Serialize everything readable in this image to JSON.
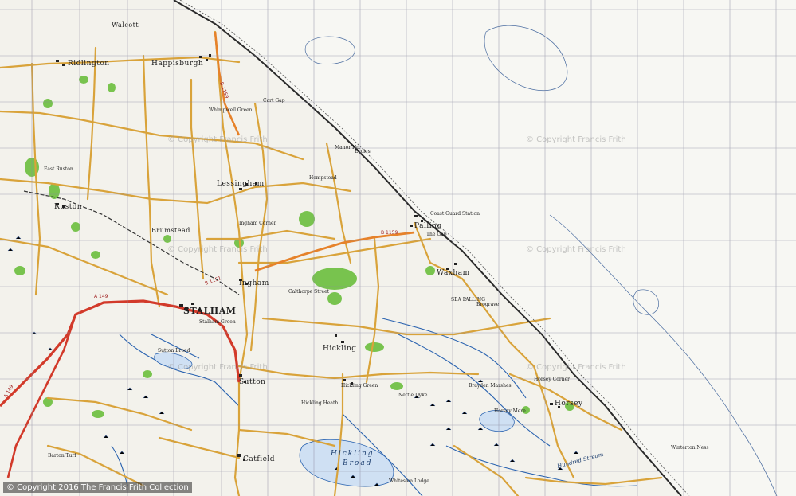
{
  "copyright": "© Copyright 2016 The Francis Frith Collection",
  "watermarks": [
    "© Copyright Francis Frith",
    "© Copyright Francis Frith",
    "© Copyright Francis Frith",
    "© Copyright Francis Frith",
    "© Copyright Francis Frith",
    "© Copyright Francis Frith"
  ],
  "colors": {
    "land": "#f3f2ec",
    "sea": "#f6f6f2",
    "grid": "#8a8aa0",
    "road": "#d9a33a",
    "aroad": "#d23a2a",
    "water": "#2a63b0",
    "wood": "#6bbf3d",
    "coast": "#2a2a2a"
  },
  "towns": {
    "stalham": "STALHAM",
    "happisburgh": "Happisburgh",
    "ridlington": "Ridlington",
    "lessingham": "Lessingham",
    "ingham": "Ingham",
    "hickling": "Hickling",
    "palling": "Palling",
    "waxham": "Waxham",
    "sutton": "Sutton",
    "catfield": "Catfield",
    "horsey": "Horsey",
    "ruston": "Ruston",
    "brumstead": "Brumstead",
    "walcott": "Walcott"
  },
  "places": {
    "hempstead": "Hempstead",
    "hickling_green": "Hickling Green",
    "eccles": "Eccles",
    "sea_palling": "SEA PALLING",
    "brograve": "Brograve",
    "horsey_mere": "Horsey Mere",
    "winterton_ness": "Winterton Ness",
    "sutton_broad": "Sutton Broad",
    "stalham_green": "Stalham Green",
    "hickling_heath": "Hickling Heath",
    "east_ruston": "East Ruston",
    "barton_turf": "Barton Turf",
    "the_gap": "The Gap",
    "coast_guard": "Coast Guard Station",
    "cart_gap": "Cart Gap",
    "manor_ho": "Manor Ho.",
    "whimpwell": "Whimpwell Green",
    "ingham_corner": "Ingham Corner",
    "calthorpe": "Calthorpe Street",
    "bryants_marshes": "Brayden Marshes",
    "horsey_corner": "Horsey Corner",
    "hickling_broad": "Hickling Broad",
    "nettle": "Nettle Dyke",
    "whiteslea": "Whiteslea Lodge"
  },
  "roadnumbers": {
    "b1159a": "B 1159",
    "b1159b": "B 1159",
    "a149a": "A 149",
    "a149b": "A 149",
    "b1151": "B 1151"
  },
  "waterways": {
    "hickling_broad": "Hickling",
    "hickling_broad2": "Broad",
    "hundred_stream": "Hundred Stream"
  }
}
